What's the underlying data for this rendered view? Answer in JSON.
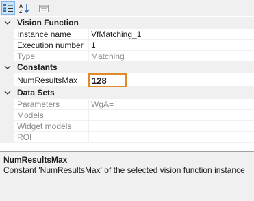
{
  "toolbar": {
    "categorized_icon": "categorized-view-icon",
    "sort_icon": "sort-az-icon",
    "pages_icon": "property-pages-icon"
  },
  "categories": [
    {
      "label": "Vision Function",
      "properties": [
        {
          "name": "Instance name",
          "value": "VfMatching_1",
          "readonly": false
        },
        {
          "name": "Execution number",
          "value": "1",
          "readonly": false
        },
        {
          "name": "Type",
          "value": "Matching",
          "readonly": true
        }
      ]
    },
    {
      "label": "Constants",
      "properties": [
        {
          "name": "NumResultsMax",
          "value": "128",
          "readonly": false,
          "selected": true
        }
      ]
    },
    {
      "label": "Data Sets",
      "properties": [
        {
          "name": "Parameters",
          "value": "WgA=",
          "readonly": true
        },
        {
          "name": "Models",
          "value": "",
          "readonly": true
        },
        {
          "name": "Widget models",
          "value": "",
          "readonly": true
        },
        {
          "name": "ROI",
          "value": "",
          "readonly": true
        }
      ]
    }
  ],
  "description": {
    "title": "NumResultsMax",
    "text": "Constant 'NumResultsMax' of the selected vision function instance"
  },
  "colors": {
    "selection_border": "#e08a2a",
    "category_bg": "#f0f0f0"
  }
}
